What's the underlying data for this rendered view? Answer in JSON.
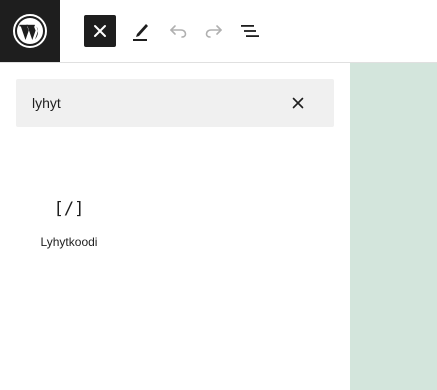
{
  "toolbar": {
    "logo_icon": "wordpress-logo-icon",
    "close_icon": "close-icon",
    "edit_icon": "pencil-icon",
    "undo_icon": "undo-icon",
    "redo_icon": "redo-icon",
    "list_view_icon": "list-view-icon"
  },
  "inserter": {
    "search": {
      "value": "lyhyt",
      "clear_icon": "close-icon"
    },
    "results": [
      {
        "icon": "[/]",
        "label": "Lyhytkoodi"
      }
    ]
  },
  "colors": {
    "logo_bg": "#1e1e1e",
    "canvas_bg": "#d3e5dc",
    "search_bg": "#f0f0f0"
  }
}
